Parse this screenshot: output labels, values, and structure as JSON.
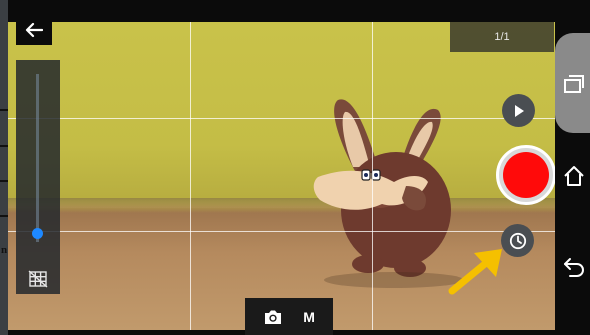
{
  "topbar": {
    "back_icon": "arrow-left-icon",
    "counter": "1/1"
  },
  "zoom": {
    "level": 0.05,
    "grid_toggle_icon": "grid-off-icon"
  },
  "controls": {
    "play_icon": "play-icon",
    "record_icon": "record-icon",
    "timer_icon": "clock-icon",
    "record_color": "#ff0a0a"
  },
  "mode_bar": {
    "photo_icon": "camera-icon",
    "mode_label": "M"
  },
  "annotation": {
    "arrow_color": "#f5c000"
  },
  "left_sliver": {
    "letter": "n"
  },
  "system_nav": {
    "recents_icon": "recents-icon",
    "home_icon": "home-icon",
    "back_icon": "back-icon"
  }
}
